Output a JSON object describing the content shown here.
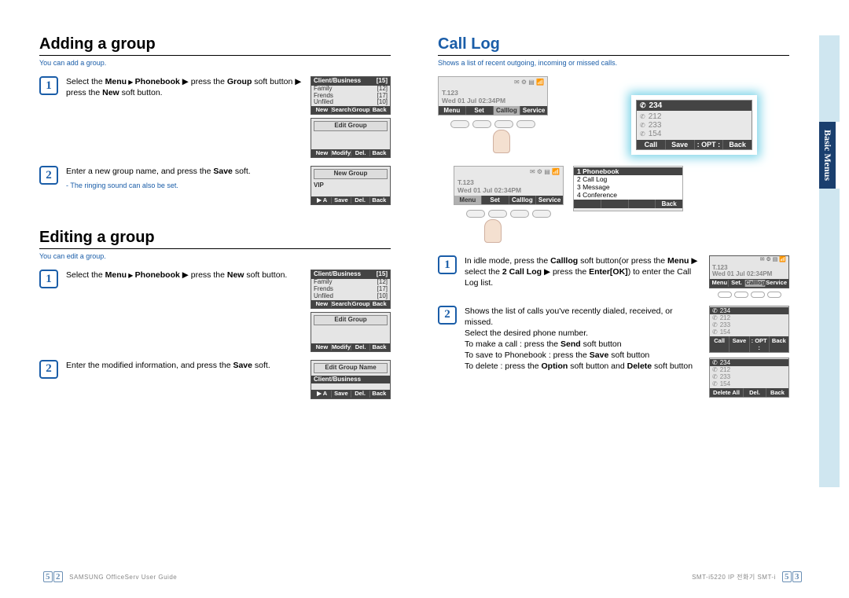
{
  "left": {
    "addGroup": {
      "title": "Adding a group",
      "intro": "You can add a group.",
      "step1": {
        "num": "1",
        "text_a": "Select the ",
        "menu": "Menu",
        "arrow": " ▶ ",
        "pb": "Phonebook",
        "text_b": " ▶ press the ",
        "group": "Group",
        "text_c": " soft button ▶ press the ",
        "new": "New",
        "text_d": " soft button."
      },
      "step2": {
        "num": "2",
        "text_a": "Enter a new group name, and press the ",
        "save": "Save",
        "text_b": " soft.",
        "note": "- The ringing sound can also be set."
      },
      "lcd1": {
        "title": "Client/Business",
        "count1": "[15]",
        "r1a": "Family",
        "r1b": "[12]",
        "r2a": "Frends",
        "r2b": "[17]",
        "r3a": "Unfiled",
        "r3b": "[10]",
        "soft": [
          "New",
          "Search",
          "Group",
          "Back"
        ]
      },
      "lcd2": {
        "edit": "Edit Group",
        "soft": [
          "New",
          "Modify",
          "Del.",
          "Back"
        ]
      },
      "lcd3": {
        "edit": "New Group",
        "vip": "VIP",
        "soft": [
          "▶ A",
          "Save",
          "Del.",
          "Back"
        ]
      }
    },
    "editGroup": {
      "title": "Editing a group",
      "intro": "You can edit a group.",
      "step1": {
        "num": "1",
        "text_a": "Select the ",
        "menu": "Menu",
        "pb": "Phonebook",
        "text_b": " ▶ press the ",
        "new": "New",
        "text_c": " soft button."
      },
      "step2": {
        "num": "2",
        "text_a": "Enter the modified information, and press the ",
        "save": "Save",
        "text_b": " soft."
      },
      "lcd3": {
        "edit": "Edit Group Name",
        "cb": "Client/Business",
        "soft": [
          "▶ A",
          "Save",
          "Del.",
          "Back"
        ]
      }
    }
  },
  "right": {
    "title": "Call Log",
    "intro": "Shows a list of recent outgoing, incoming or missed calls.",
    "idle": {
      "lbl": "T.123",
      "tm": "Wed 01 Jul 02:34PM",
      "soft": [
        "Menu",
        "Set",
        "Calllog",
        "Service"
      ]
    },
    "menu": {
      "hl": "1 Phonebook",
      "i2": "2 Call Log",
      "i3": "3 Message",
      "i4": "4 Conference",
      "back": "Back"
    },
    "hero": {
      "n1": "234",
      "n2": "212",
      "n3": "233",
      "n4": "154",
      "soft": [
        "Call",
        "Save",
        ": OPT :",
        "Back"
      ]
    },
    "step1": {
      "num": "1",
      "text_a": "In idle mode, press the ",
      "cl": "Calllog",
      "text_b": " soft button(or press the ",
      "menu": "Menu",
      "text_c": " ▶ select the ",
      "cl2": "2 Call Log",
      "text_d": " ▶ press the ",
      "enter": "Enter[OK]",
      "text_e": ") to enter the Call Log list."
    },
    "step1lcd": {
      "lbl": "T.123",
      "tm": "Wed 01 Jul 02:34PM",
      "soft": [
        "Menu",
        "Set.",
        "Calllog",
        "Service"
      ]
    },
    "step2": {
      "num": "2",
      "l1": "Shows the list of calls you've recently dialed, received, or missed.",
      "l2": "Select the desired phone number.",
      "l3a": "To make a call : press the ",
      "send": "Send",
      "l3b": " soft button",
      "l4a": "To save to Phonebook : press the ",
      "save": "Save",
      "l4b": " soft button",
      "l5a": "To delete : press the ",
      "opt": "Option",
      "l5b": " soft button and ",
      "del": "Delete",
      "l5c": " soft button"
    },
    "step2lcd1": {
      "n1": "234",
      "n2": "212",
      "n3": "233",
      "n4": "154",
      "soft": [
        "Call",
        "Save",
        ": OPT :",
        "Back"
      ]
    },
    "step2lcd2": {
      "n1": "234",
      "n2": "212",
      "n3": "233",
      "n4": "154",
      "soft": [
        "Delete All",
        "Del.",
        "Back"
      ]
    },
    "vtab": "Basic Menus"
  },
  "footer": {
    "left_page": "52",
    "left_text": "SAMSUNG OfficeServ User Guide",
    "right_text": "SMT-i5220 IP 전화기 SMT-i",
    "right_page": "53"
  }
}
